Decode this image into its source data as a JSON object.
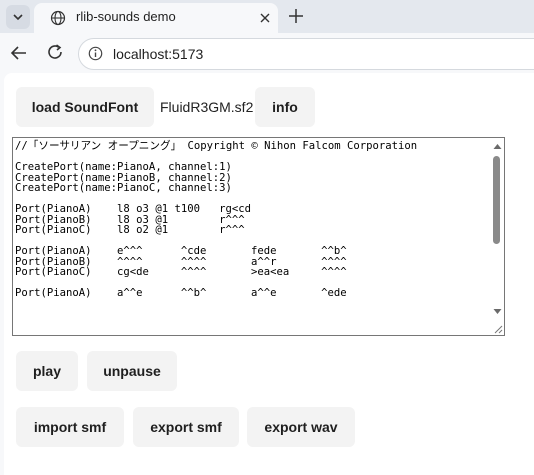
{
  "browser": {
    "tab_title": "rlib-sounds demo",
    "url": "localhost:5173"
  },
  "toolbar": {
    "load_label": "load SoundFont",
    "soundfont_file": "FluidR3GM.sf2",
    "info_label": "info"
  },
  "editor": {
    "text": "//「ソーサリアン オープニング」 Copyright © Nihon Falcom Corporation\n\nCreatePort(name:PianoA, channel:1)\nCreatePort(name:PianoB, channel:2)\nCreatePort(name:PianoC, channel:3)\n\nPort(PianoA)    l8 o3 @1 t100   rg<cd\nPort(PianoB)    l8 o3 @1        r^^^\nPort(PianoC)    l8 o2 @1        r^^^\n\nPort(PianoA)    e^^^      ^cde       fede       ^^b^\nPort(PianoB)    ^^^^      ^^^^       a^^r       ^^^^\nPort(PianoC)    cg<de     ^^^^       >ea<ea     ^^^^\n\nPort(PianoA)    a^^e      ^^b^       a^^e       ^ede"
  },
  "playback": {
    "play_label": "play",
    "unpause_label": "unpause"
  },
  "io": {
    "import_label": "import smf",
    "export_smf_label": "export smf",
    "export_wav_label": "export wav"
  }
}
